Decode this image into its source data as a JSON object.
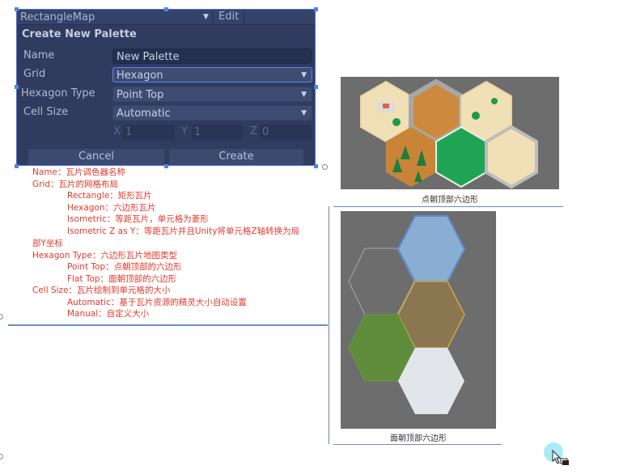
{
  "dialog": {
    "map_selector": "RectangleMap",
    "edit_label": "Edit",
    "title": "Create New Palette",
    "fields": {
      "name_label": "Name",
      "name_value": "New Palette",
      "grid_label": "Grid",
      "grid_value": "Hexagon",
      "hex_type_label": "Hexagon Type",
      "hex_type_value": "Point Top",
      "cell_size_label": "Cell Size",
      "cell_size_value": "Automatic",
      "x_label": "X",
      "x_value": "1",
      "y_label": "Y",
      "y_value": "1",
      "z_label": "Z",
      "z_value": "0"
    },
    "cancel_label": "Cancel",
    "create_label": "Create"
  },
  "notes": [
    "Name：瓦片调色器名称",
    "Grid：瓦片的网格布局",
    "Rectangle：矩形瓦片",
    "Hexagon：六边形瓦片",
    "Isometric：等距瓦片，单元格为菱形",
    "Isometric Z as Y：等距瓦片并且Unity将单元格Z轴转换为局",
    "部Y坐标",
    "Hexagon Type：六边形瓦片地图类型",
    "Point Top：点朝顶部的六边形",
    "Flat Top：面朝顶部的六边形",
    "Cell Size：瓦片绘制到单元格的大小",
    "Automatic：基于瓦片资源的精灵大小自动设置",
    "Manual：自定义大小"
  ],
  "images": {
    "point_top_caption": "点朝顶部六边形",
    "flat_top_caption": "面朝顶部六边形"
  },
  "colors": {
    "dialog_bg": "#2f3c5f",
    "annotation_text": "#e03a2e",
    "selection_border": "#4f83e6"
  }
}
